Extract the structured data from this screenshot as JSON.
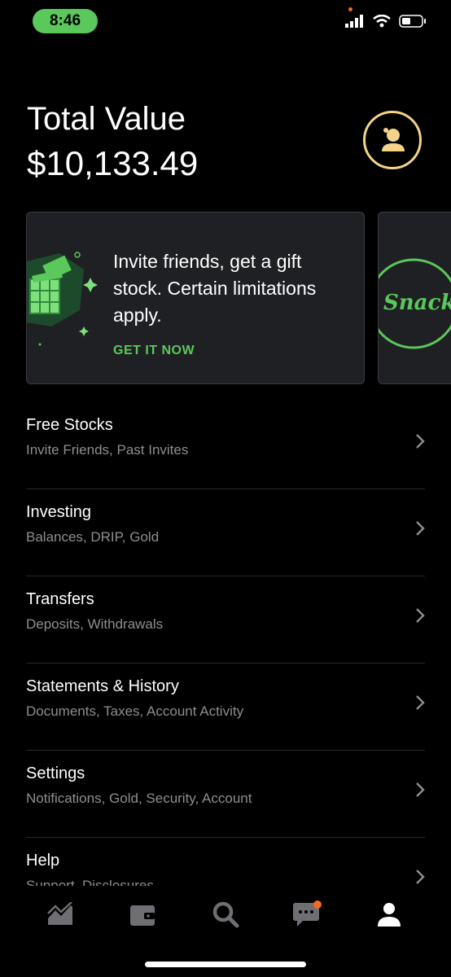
{
  "status_bar": {
    "time": "8:46"
  },
  "header": {
    "title": "Total Value",
    "total_value": "$10,133.49"
  },
  "promo": {
    "text": "Invite friends, get a gift stock. Certain limitations apply.",
    "cta": "GET IT NOW",
    "next_card_logo_text": "Snacks"
  },
  "menu": [
    {
      "title": "Free Stocks",
      "subtitle": "Invite Friends, Past Invites"
    },
    {
      "title": "Investing",
      "subtitle": "Balances, DRIP, Gold"
    },
    {
      "title": "Transfers",
      "subtitle": "Deposits, Withdrawals"
    },
    {
      "title": "Statements & History",
      "subtitle": "Documents, Taxes, Account Activity"
    },
    {
      "title": "Settings",
      "subtitle": "Notifications, Gold, Security, Account"
    },
    {
      "title": "Help",
      "subtitle": "Support, Disclosures"
    }
  ],
  "tabbar": {
    "items": [
      "chart-icon",
      "wallet-icon",
      "search-icon",
      "messages-icon",
      "profile-icon"
    ],
    "active": "profile-icon"
  },
  "colors": {
    "accent_green": "#5ac85a",
    "gold": "#f5d38a",
    "notification": "#f26a21"
  }
}
